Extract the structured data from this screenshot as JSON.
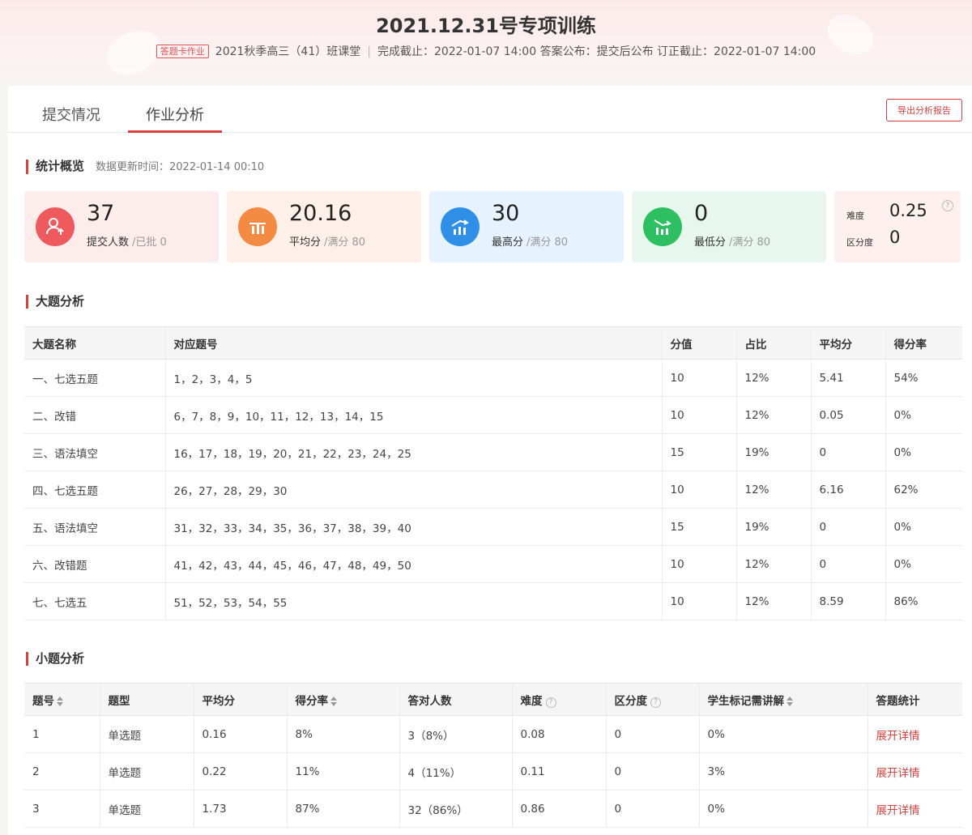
{
  "header": {
    "title": "2021.12.31号专项训练",
    "tag": "答题卡作业",
    "class_name": "2021秋季高三（41）班课堂",
    "separator": "|",
    "deadline": "完成截止：2022-01-07 14:00",
    "answer_publish": "答案公布：提交后公布",
    "correction_deadline": "订正截止：2022-01-07 14:00"
  },
  "tabs": [
    {
      "label": "提交情况"
    },
    {
      "label": "作业分析",
      "active": true
    }
  ],
  "export_button": "导出分析报告",
  "overview": {
    "title": "统计概览",
    "update_time": "数据更新时间：2022-01-14 00:10",
    "cards": [
      {
        "value": "37",
        "label": "提交人数",
        "sub": "/已批 0",
        "bg": "#fdecec",
        "icon_bg": "#ef5a5f"
      },
      {
        "value": "20.16",
        "label": "平均分",
        "sub": "/满分 80",
        "bg": "#fdf0e8",
        "icon_bg": "#f58a42"
      },
      {
        "value": "30",
        "label": "最高分",
        "sub": "/满分 80",
        "bg": "#e6f2fd",
        "icon_bg": "#2f8ee6"
      },
      {
        "value": "0",
        "label": "最低分",
        "sub": "/满分 80",
        "bg": "#e8f7ee",
        "icon_bg": "#2fbf63"
      }
    ],
    "difficulty_label": "难度",
    "difficulty_value": "0.25",
    "discrimination_label": "区分度",
    "discrimination_value": "0",
    "help": "?"
  },
  "major": {
    "title": "大题分析",
    "columns": [
      "大题名称",
      "对应题号",
      "分值",
      "占比",
      "平均分",
      "得分率"
    ],
    "rows": [
      [
        "一、七选五题",
        "1，2，3，4，5",
        "10",
        "12%",
        "5.41",
        "54%"
      ],
      [
        "二、改错",
        "6，7，8，9，10，11，12，13，14，15",
        "10",
        "12%",
        "0.05",
        "0%"
      ],
      [
        "三、语法填空",
        "16，17，18，19，20，21，22，23，24，25",
        "15",
        "19%",
        "0",
        "0%"
      ],
      [
        "四、七选五题",
        "26，27，28，29，30",
        "10",
        "12%",
        "6.16",
        "62%"
      ],
      [
        "五、语法填空",
        "31，32，33，34，35，36，37，38，39，40",
        "15",
        "19%",
        "0",
        "0%"
      ],
      [
        "六、改错题",
        "41，42，43，44，45，46，47，48，49，50",
        "10",
        "12%",
        "0",
        "0%"
      ],
      [
        "七、七选五",
        "51，52，53，54，55",
        "10",
        "12%",
        "8.59",
        "86%"
      ]
    ]
  },
  "minor": {
    "title": "小题分析",
    "columns": [
      "题号",
      "题型",
      "平均分",
      "得分率",
      "答对人数",
      "难度",
      "区分度",
      "学生标记需讲解",
      "答题统计"
    ],
    "rows": [
      [
        "1",
        "单选题",
        "0.16",
        "8%",
        "3（8%）",
        "0.08",
        "0",
        "0%",
        "展开详情"
      ],
      [
        "2",
        "单选题",
        "0.22",
        "11%",
        "4（11%）",
        "0.11",
        "0",
        "3%",
        "展开详情"
      ],
      [
        "3",
        "单选题",
        "1.73",
        "87%",
        "32（86%）",
        "0.86",
        "0",
        "0%",
        "展开详情"
      ]
    ]
  }
}
